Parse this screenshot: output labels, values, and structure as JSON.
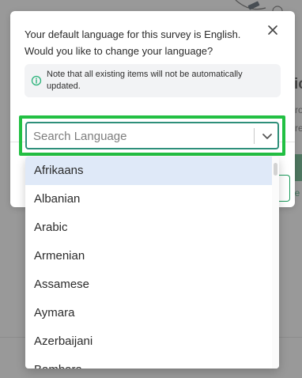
{
  "modal": {
    "message": "Your default language for this survey is English. Would you like to change your language?",
    "note": "Note that all existing items will not be automatically updated."
  },
  "language_select": {
    "placeholder": "Search Language",
    "options": [
      "Afrikaans",
      "Albanian",
      "Arabic",
      "Armenian",
      "Assamese",
      "Aymara",
      "Azerbaijani",
      "Bambara"
    ],
    "selected_index": 0
  },
  "colors": {
    "accent_teal": "#2e8f7a",
    "highlight_green": "#22c043",
    "selected_option_bg": "#dfe9f8",
    "brand_green": "#1a9a5a"
  },
  "icons": {
    "close": "close-icon",
    "info": "info-icon",
    "dropdown": "chevron-down-icon"
  }
}
